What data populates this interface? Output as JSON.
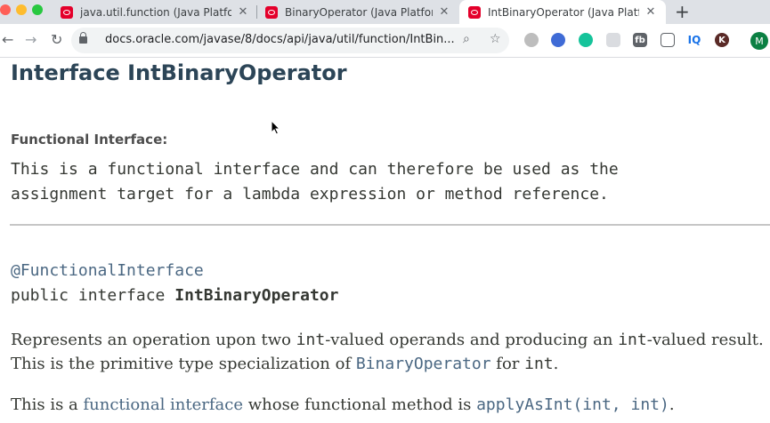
{
  "browser": {
    "tabs": [
      {
        "title": "java.util.function (Java Platform",
        "close": "✕"
      },
      {
        "title": "BinaryOperator (Java Platform",
        "close": "✕"
      },
      {
        "title": "IntBinaryOperator (Java Platfor",
        "close": "✕"
      }
    ],
    "new_tab": "+",
    "url": "docs.oracle.com/javase/8/docs/api/java/util/function/IntBin...",
    "extensions": [
      "fb",
      "IQ",
      "K"
    ],
    "profile_initial": "M"
  },
  "page": {
    "title": "Interface IntBinaryOperator",
    "functional_label": "Functional Interface:",
    "functional_text_line1": "This is a functional interface and can therefore be used as the",
    "functional_text_line2": "assignment target for a lambda expression or method reference.",
    "annotation": "@FunctionalInterface",
    "declaration_prefix": "public interface ",
    "declaration_name": "IntBinaryOperator",
    "desc": {
      "p1": "Represents an operation upon two ",
      "c1": "int",
      "p2": "-valued operands and producing an ",
      "c2": "int",
      "p3": "-valued result. This is the primitive type specialization of ",
      "link": "BinaryOperator",
      "p4": " for ",
      "c3": "int",
      "p5": "."
    },
    "desc2": {
      "p1": "This is a ",
      "link": "functional interface",
      "p2": " whose functional method is ",
      "method": "applyAsInt(int, int)",
      "p3": "."
    }
  }
}
